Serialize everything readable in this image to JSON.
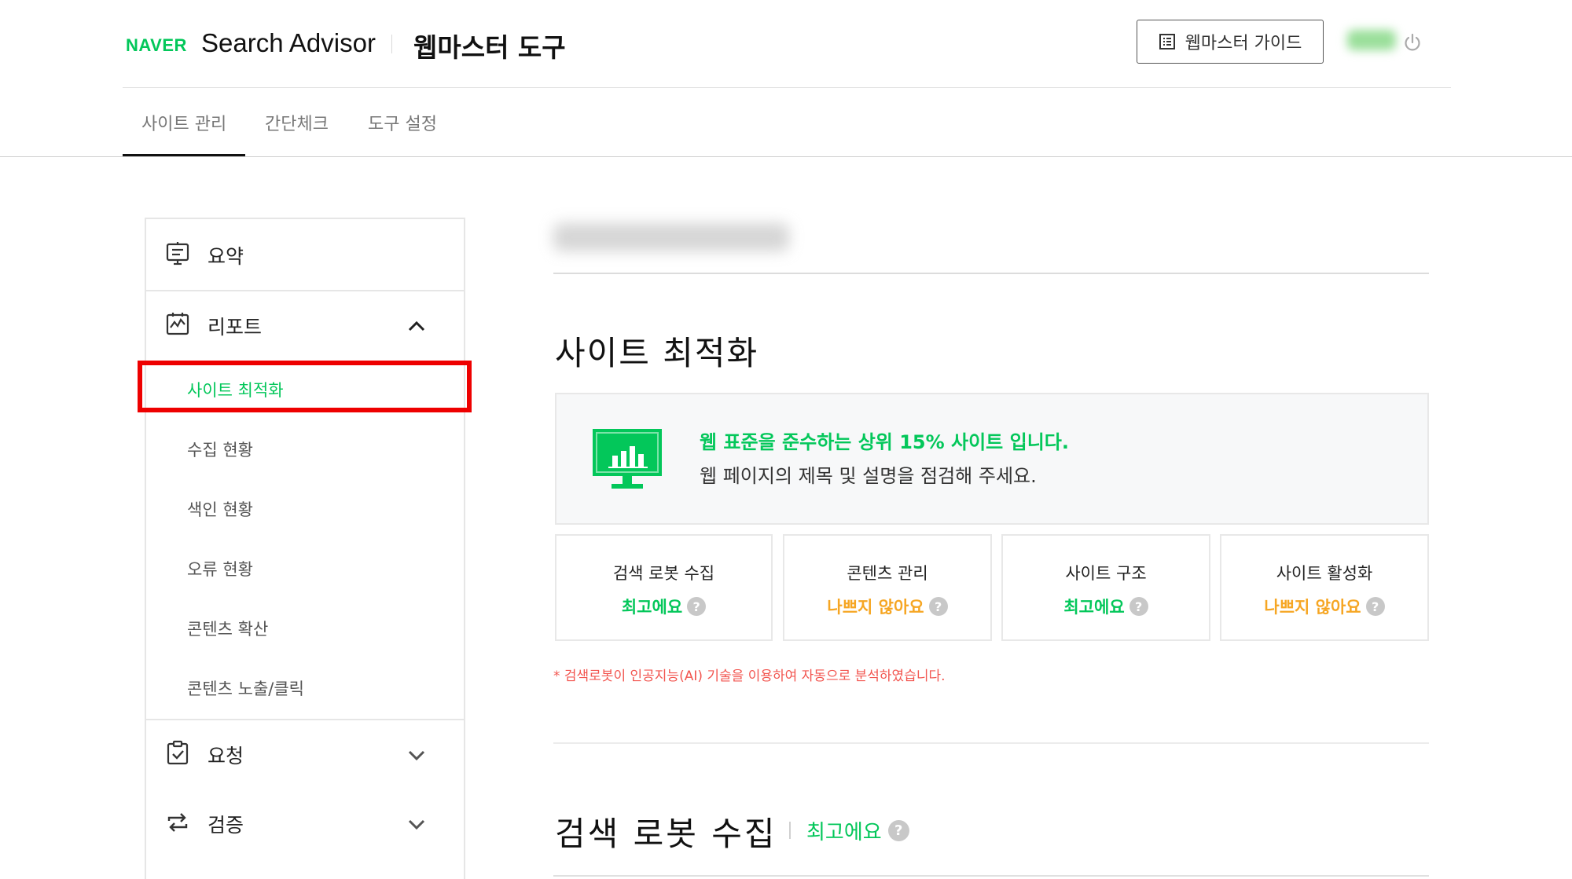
{
  "header": {
    "brand": "NAVER",
    "app_name": "Search Advisor",
    "title": "웹마스터 도구",
    "guide_button": "웹마스터 가이드"
  },
  "tabs": [
    {
      "label": "사이트 관리",
      "active": true
    },
    {
      "label": "간단체크",
      "active": false
    },
    {
      "label": "도구 설정",
      "active": false
    }
  ],
  "sidebar": {
    "summary": "요약",
    "report": "리포트",
    "report_items": [
      "사이트 최적화",
      "수집 현황",
      "색인 현황",
      "오류 현황",
      "콘텐츠 확산",
      "콘텐츠 노출/클릭"
    ],
    "request": "요청",
    "verify": "검증"
  },
  "main": {
    "section_title": "사이트 최적화",
    "summary_headline": "웹 표준을 준수하는 상위 15% 사이트 입니다.",
    "summary_sub": "웹 페이지의 제목 및 설명을 점검해 주세요.",
    "cards": [
      {
        "title": "검색 로봇 수집",
        "status": "최고에요",
        "level": "good"
      },
      {
        "title": "콘텐츠 관리",
        "status": "나쁘지 않아요",
        "level": "okay"
      },
      {
        "title": "사이트 구조",
        "status": "최고에요",
        "level": "good"
      },
      {
        "title": "사이트 활성화",
        "status": "나쁘지 않아요",
        "level": "okay"
      }
    ],
    "help_glyph": "?",
    "ai_note": "* 검색로봇이 인공지능(AI) 기술을 이용하여 자동으로 분석하였습니다.",
    "crawl_title": "검색 로봇 수집",
    "crawl_status": "최고에요"
  },
  "colors": {
    "brand_green": "#03c75a",
    "okay_orange": "#f6a623",
    "note_red": "#f2554f",
    "highlight_red": "#ee0000"
  }
}
